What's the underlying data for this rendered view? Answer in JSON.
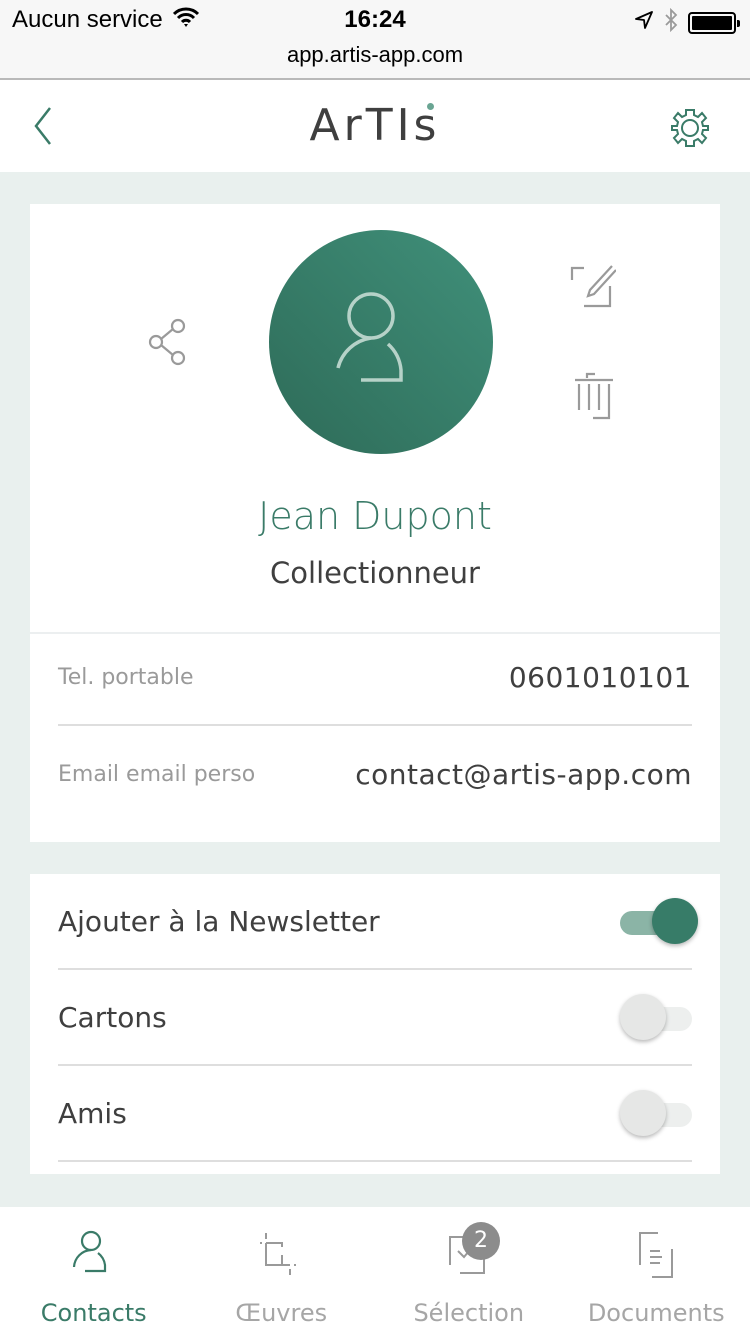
{
  "status_bar": {
    "carrier": "Aucun service",
    "time": "16:24",
    "url": "app.artis-app.com"
  },
  "header": {
    "logo_text": "ArTIs",
    "back_icon": "chevron-left-icon",
    "settings_icon": "gear-icon"
  },
  "profile": {
    "name": "Jean Dupont",
    "role": "Collectionneur",
    "actions": {
      "share_icon": "share-icon",
      "edit_icon": "edit-icon",
      "delete_icon": "trash-icon"
    },
    "fields": [
      {
        "label": "Tel. portable",
        "value": "0601010101"
      },
      {
        "label": "Email email perso",
        "value": "contact@artis-app.com"
      }
    ]
  },
  "toggles": [
    {
      "label": "Ajouter à la Newsletter",
      "checked": true
    },
    {
      "label": "Cartons",
      "checked": false
    },
    {
      "label": "Amis",
      "checked": false
    }
  ],
  "tabbar": {
    "tabs": [
      {
        "label": "Contacts",
        "icon": "user-icon",
        "active": true
      },
      {
        "label": "Œuvres",
        "icon": "crop-icon",
        "active": false
      },
      {
        "label": "Sélection",
        "icon": "checkbox-icon",
        "active": false,
        "badge": "2"
      },
      {
        "label": "Documents",
        "icon": "document-icon",
        "active": false
      }
    ]
  },
  "colors": {
    "accent": "#3a7b68",
    "background": "#e9f0ee",
    "muted_text": "#9a9a9a",
    "badge": "#8c8c8c"
  }
}
